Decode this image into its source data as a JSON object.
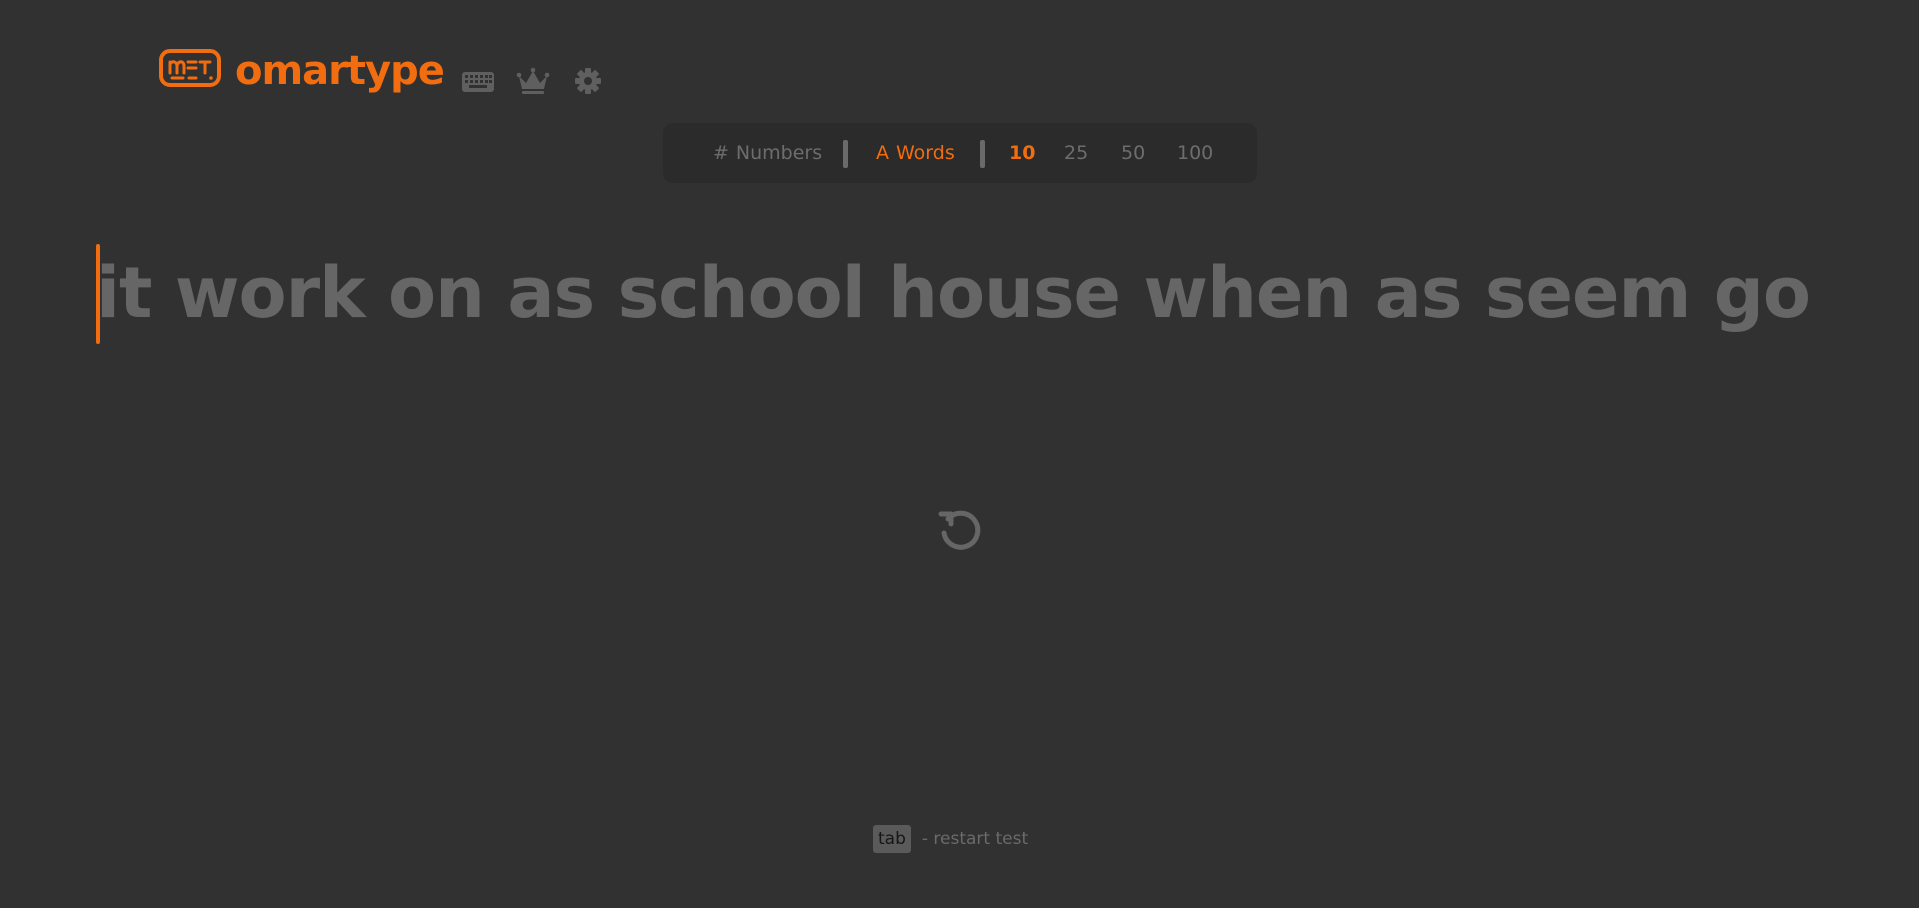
{
  "app": {
    "brand": "omartype",
    "accent_color": "#f26d0f",
    "background_color": "#313131"
  },
  "nav": {
    "icons": [
      "keyboard-icon",
      "crown-icon",
      "gear-icon"
    ]
  },
  "mode_bar": {
    "modes": [
      {
        "glyph": "#",
        "label": "Numbers",
        "active": false
      },
      {
        "glyph": "A",
        "label": "Words",
        "active": true
      }
    ],
    "word_counts": [
      {
        "label": "10",
        "active": true
      },
      {
        "label": "25",
        "active": false
      },
      {
        "label": "50",
        "active": false
      },
      {
        "label": "100",
        "active": false
      }
    ]
  },
  "test": {
    "words": "it work on as school house when as seem go"
  },
  "footer": {
    "key": "tab",
    "text": "- restart test"
  }
}
